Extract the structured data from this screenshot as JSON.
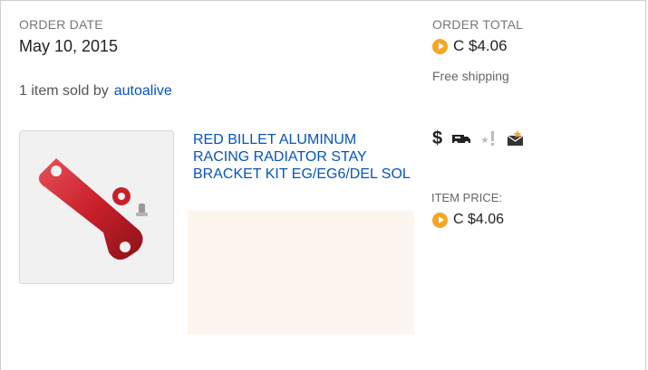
{
  "order": {
    "date_label": "ORDER DATE",
    "date_value": "May 10, 2015",
    "total_label": "ORDER TOTAL",
    "currency_icon": "coin-icon",
    "total_value": "C $4.06",
    "shipping": "Free shipping",
    "sold_by_prefix": "1 item sold by",
    "seller": "autoalive"
  },
  "item": {
    "title": "RED BILLET ALUMINUM RACING RADIATOR STAY BRACKET KIT EG/EG6/DEL SOL",
    "price_label": "ITEM PRICE:",
    "price_value": "C $4.06",
    "status_icons": [
      "dollar-icon",
      "shipping-truck-icon",
      "star-feedback-icon",
      "envelope-star-icon"
    ]
  },
  "colors": {
    "link": "#0654ba",
    "coin": "#f5a623",
    "product_red": "#c8202a"
  }
}
